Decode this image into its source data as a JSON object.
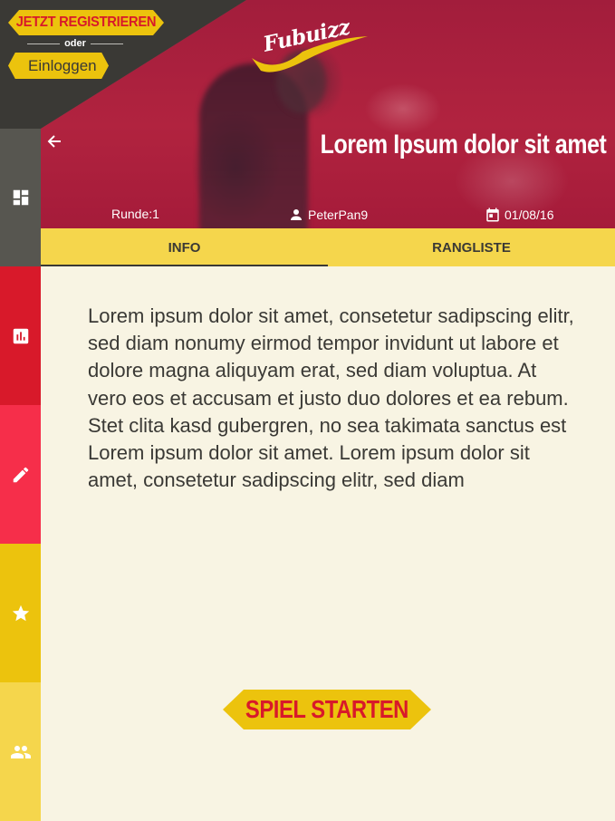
{
  "header": {
    "register_label": "JETZT REGISTRIEREN",
    "or_label": "oder",
    "login_label": "Einloggen",
    "logo_text": "Fubuizz"
  },
  "hero": {
    "title": "Lorem Ipsum dolor sit amet",
    "round": "Runde:1",
    "user": "PeterPan9",
    "date": "01/08/16"
  },
  "sidebar": {
    "items": [
      {
        "icon": "dashboard-icon",
        "color": "#575650"
      },
      {
        "icon": "bar-chart-icon",
        "color": "#d8192a"
      },
      {
        "icon": "pencil-icon",
        "color": "#f62e4a"
      },
      {
        "icon": "star-icon",
        "color": "#ecc30d"
      },
      {
        "icon": "people-icon",
        "color": "#f5d64c"
      }
    ]
  },
  "tabs": [
    {
      "label": "INFO",
      "active": true
    },
    {
      "label": "RANGLISTE",
      "active": false
    }
  ],
  "content": {
    "text": "Lorem ipsum dolor sit amet, consetetur sadipscing elitr, sed diam nonumy eirmod tempor invidunt ut labore et dolore magna aliquyam erat, sed diam voluptua. At vero eos et accusam et justo duo dolores et ea rebum. Stet clita kasd gubergren, no sea takimata sanctus est Lorem ipsum dolor sit amet. Lorem ipsum dolor sit amet, consetetur sadipscing elitr, sed diam",
    "start_label": "SPIEL STARTEN"
  },
  "colors": {
    "accent_yellow": "#ecc30d",
    "accent_red": "#d8192a",
    "dark": "#3a3935",
    "background": "#f8f4e3"
  }
}
